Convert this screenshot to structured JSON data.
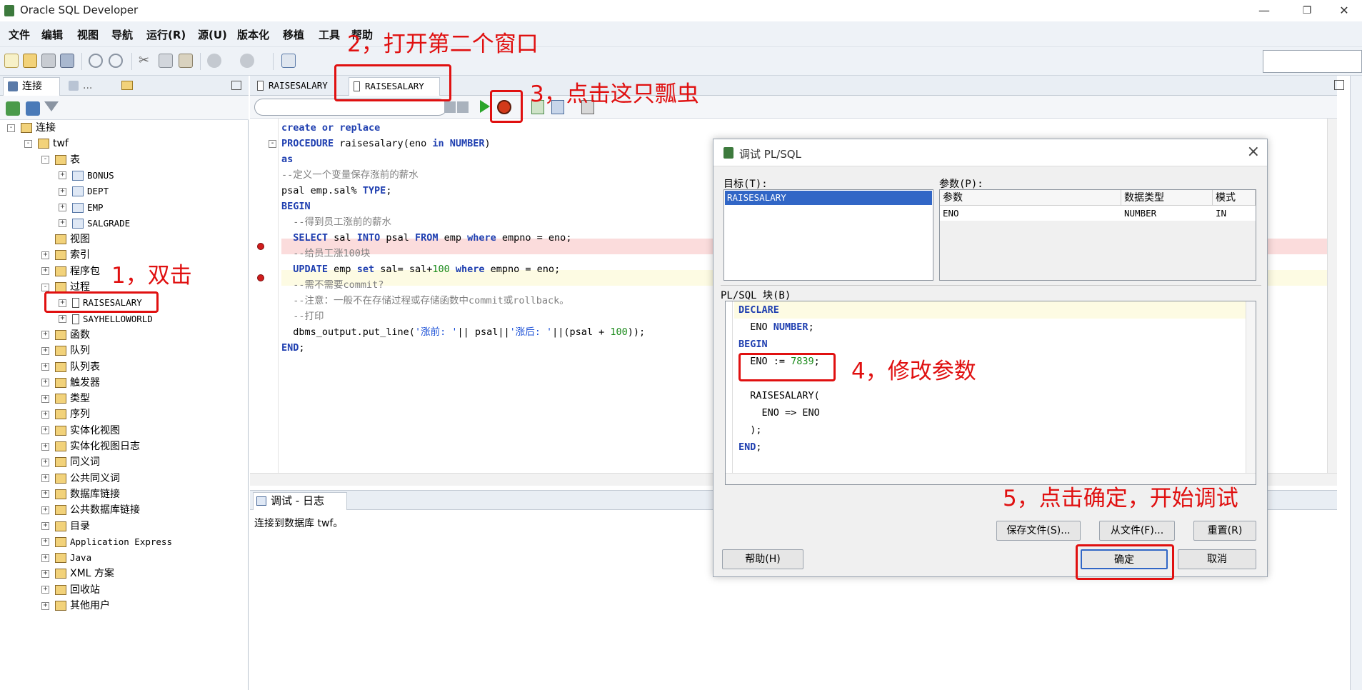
{
  "window": {
    "title": "Oracle SQL Developer"
  },
  "menu": [
    "文件",
    "编辑",
    "视图",
    "导航",
    "运行(R)",
    "源(U)",
    "版本化",
    "移植",
    "工具",
    "帮助"
  ],
  "left_panel": {
    "tabs": [
      "连接",
      "...",
      ""
    ],
    "tree": [
      {
        "label": "连接",
        "level": 0,
        "exp": "-"
      },
      {
        "label": "twf",
        "level": 1,
        "exp": "-"
      },
      {
        "label": "表",
        "level": 2,
        "exp": "-"
      },
      {
        "label": "BONUS",
        "level": 3,
        "exp": "+",
        "mono": true
      },
      {
        "label": "DEPT",
        "level": 3,
        "exp": "+",
        "mono": true
      },
      {
        "label": "EMP",
        "level": 3,
        "exp": "+",
        "mono": true
      },
      {
        "label": "SALGRADE",
        "level": 3,
        "exp": "+",
        "mono": true
      },
      {
        "label": "视图",
        "level": 2,
        "exp": ""
      },
      {
        "label": "索引",
        "level": 2,
        "exp": "+"
      },
      {
        "label": "程序包",
        "level": 2,
        "exp": "+"
      },
      {
        "label": "过程",
        "level": 2,
        "exp": "-"
      },
      {
        "label": "RAISESALARY",
        "level": 3,
        "exp": "+",
        "mono": true,
        "proc": true
      },
      {
        "label": "SAYHELLOWORLD",
        "level": 3,
        "exp": "+",
        "mono": true,
        "proc": true
      },
      {
        "label": "函数",
        "level": 2,
        "exp": "+"
      },
      {
        "label": "队列",
        "level": 2,
        "exp": "+"
      },
      {
        "label": "队列表",
        "level": 2,
        "exp": "+"
      },
      {
        "label": "触发器",
        "level": 2,
        "exp": "+"
      },
      {
        "label": "类型",
        "level": 2,
        "exp": "+"
      },
      {
        "label": "序列",
        "level": 2,
        "exp": "+"
      },
      {
        "label": "实体化视图",
        "level": 2,
        "exp": "+"
      },
      {
        "label": "实体化视图日志",
        "level": 2,
        "exp": "+"
      },
      {
        "label": "同义词",
        "level": 2,
        "exp": "+"
      },
      {
        "label": "公共同义词",
        "level": 2,
        "exp": "+"
      },
      {
        "label": "数据库链接",
        "level": 2,
        "exp": "+"
      },
      {
        "label": "公共数据库链接",
        "level": 2,
        "exp": "+"
      },
      {
        "label": "目录",
        "level": 2,
        "exp": "+"
      },
      {
        "label": "Application Express",
        "level": 2,
        "exp": "+",
        "mono": true
      },
      {
        "label": "Java",
        "level": 2,
        "exp": "+",
        "mono": true
      },
      {
        "label": "XML 方案",
        "level": 2,
        "exp": "+"
      },
      {
        "label": "回收站",
        "level": 2,
        "exp": "+"
      },
      {
        "label": "其他用户",
        "level": 2,
        "exp": "+"
      }
    ]
  },
  "editor": {
    "tabs": [
      "RAISESALARY",
      "RAISESALARY"
    ],
    "code": [
      "create or replace",
      "PROCEDURE raisesalary(eno in NUMBER)",
      "as",
      "--定义一个变量保存涨前的薪水",
      "psal emp.sal% TYPE;",
      "BEGIN",
      "  --得到员工涨前的薪水",
      "  SELECT sal INTO psal FROM emp where empno = eno;",
      "  --给员工涨100块",
      "  UPDATE emp set sal= sal+100 where empno = eno;",
      "  --需不需要commit?",
      "  --注意：一般不在存储过程或存储函数中commit或rollback。",
      "  --打印",
      "  dbms_output.put_line('涨前: '|| psal||'涨后: '||(psal + 100));",
      "END;"
    ]
  },
  "log": {
    "tab_label": "调试 - 日志",
    "message": "连接到数据库 twf。"
  },
  "dialog": {
    "title": "调试 PL/SQL",
    "target_label": "目标(T):",
    "target_selected": "RAISESALARY",
    "params_label": "参数(P):",
    "param_headers": [
      "参数",
      "数据类型",
      "模式"
    ],
    "param_row": [
      "ENO",
      "NUMBER",
      "IN"
    ],
    "block_label": "PL/SQL 块(B)",
    "block_lines": [
      "DECLARE",
      "  ENO NUMBER;",
      "BEGIN",
      "  ENO := 7839;",
      "",
      "  RAISESALARY(",
      "    ENO => ENO",
      "  );",
      "END;"
    ],
    "buttons": {
      "save_file": "保存文件(S)...",
      "from_file": "从文件(F)...",
      "reset": "重置(R)",
      "help": "帮助(H)",
      "ok": "确定",
      "cancel": "取消"
    }
  },
  "annotations": {
    "a1": "1，双击",
    "a2": "2，打开第二个窗口",
    "a3": "3，点击这只瓢虫",
    "a4": "4，修改参数",
    "a5": "5，点击确定，开始调试"
  },
  "colors": {
    "annotation": "#e01010",
    "keyword": "#1f3fb0",
    "selection": "#3166c6"
  }
}
